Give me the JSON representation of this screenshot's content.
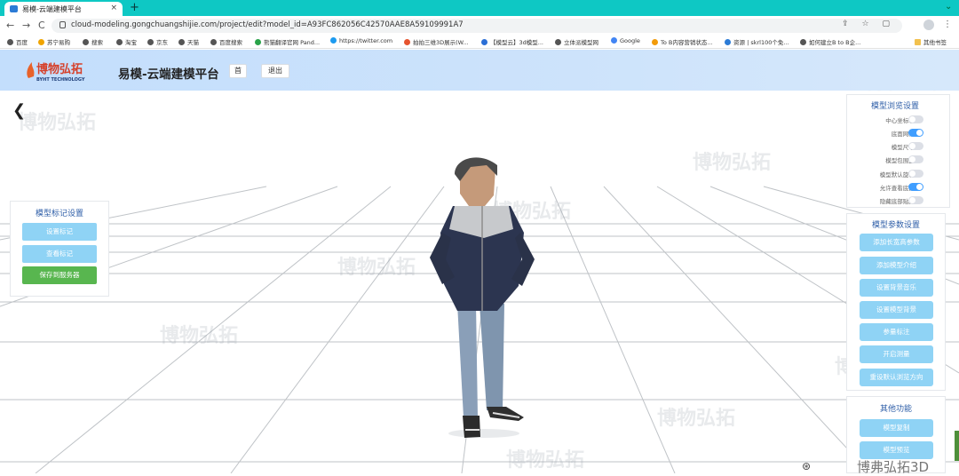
{
  "browser": {
    "tab_title": "易模-云端建模平台",
    "tab_close": "×",
    "new_tab": "+",
    "window_min": "⌄",
    "url": "cloud-modeling.gongchuangshijie.com/project/edit?model_id=A93FC862056C42570AAE8A59109991A7",
    "back": "←",
    "forward": "→",
    "reload": "C",
    "kebab": "⋮",
    "bookmarks": [
      "百度",
      "苏宁易购",
      "搜索",
      "淘宝",
      "京东",
      "天猫",
      "百度搜索",
      "熊猫翻译官网 Pand...",
      "https://twitter.com",
      "拍拍三维3D展示(W...",
      "【模型云】3d模型...",
      "立体派模型网",
      "Google",
      "To B内容营销状态...",
      "资源 | skrl100个免...",
      "如何建立B to B企...",
      "其他书签"
    ]
  },
  "header": {
    "logo_text": "博物弘拓",
    "logo_sub": "BYHT TECHNOLOGY",
    "title": "易模-云端建模平台",
    "btn_home": "首",
    "btn_exit": "退出"
  },
  "left_panel": {
    "title": "模型标记设置",
    "set_mark": "设置标记",
    "view_mark": "查看标记",
    "save_server": "保存到服务器"
  },
  "view_panel": {
    "title": "模型浏览设置",
    "settings": [
      {
        "label": "中心坐标轴:",
        "on": false
      },
      {
        "label": "底面网格:",
        "on": true
      },
      {
        "label": "模型尺寸:",
        "on": false
      },
      {
        "label": "模型包围盒:",
        "on": false
      },
      {
        "label": "模型默认旋转:",
        "on": false
      },
      {
        "label": "允许查看底部:",
        "on": true
      },
      {
        "label": "隐藏底部贴图:",
        "on": false
      }
    ]
  },
  "param_panel": {
    "title": "模型参数设置",
    "buttons": [
      "添加长宽高参数",
      "添加模型介绍",
      "设置背景音乐",
      "设置模型背景",
      "参量标注",
      "开启测量",
      "重设默认浏览方向"
    ]
  },
  "other_panel": {
    "title": "其他功能",
    "buttons": [
      "模型复制",
      "模型预览"
    ]
  },
  "watermark": {
    "name": "博物弘拓",
    "sub": "BYHT TECHNOLOGY",
    "bottom": "博弗弘拓3D"
  },
  "colors": {
    "tabstrip": "#0ec8c4",
    "header": "#cde3fb",
    "button_blue": "#8fd3f5",
    "button_green": "#58b64f",
    "switch_on": "#409eff"
  }
}
